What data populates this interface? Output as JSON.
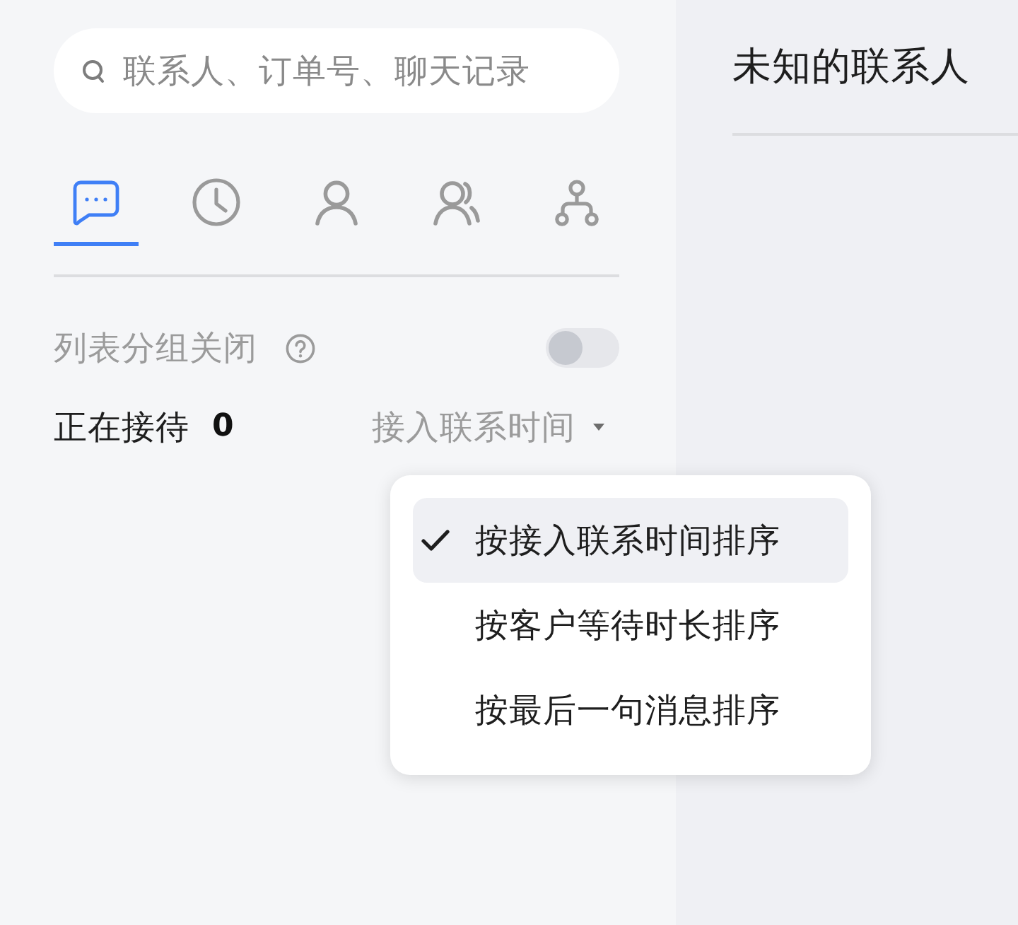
{
  "search": {
    "placeholder": "联系人、订单号、聊天记录"
  },
  "tabs": [
    {
      "selected": true
    },
    {
      "selected": false
    },
    {
      "selected": false
    },
    {
      "selected": false
    },
    {
      "selected": false
    }
  ],
  "grouping": {
    "label": "列表分组关闭",
    "on": false
  },
  "queue": {
    "label": "正在接待",
    "count": "0",
    "sort": "接入联系时间"
  },
  "sort_menu": {
    "items": [
      {
        "label": "按接入联系时间排序",
        "selected": true
      },
      {
        "label": "按客户等待时长排序",
        "selected": false
      },
      {
        "label": "按最后一句消息排序",
        "selected": false
      }
    ]
  },
  "contact": {
    "title": "未知的联系人"
  }
}
